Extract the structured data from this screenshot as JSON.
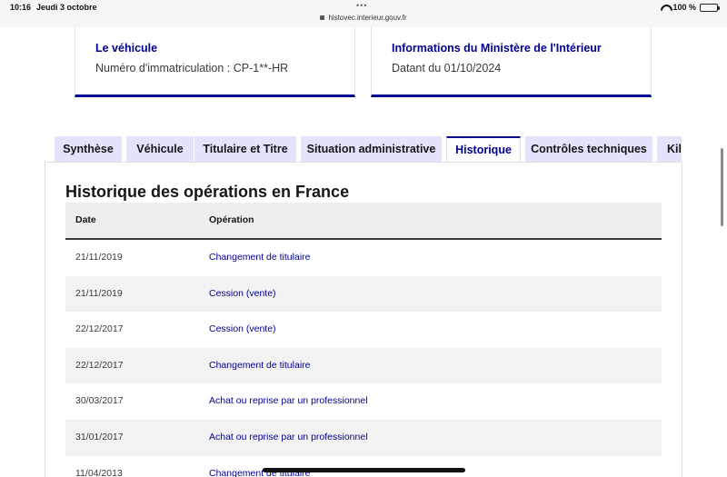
{
  "status_bar": {
    "time": "10:16",
    "date": "Jeudi 3 octobre",
    "url": "histovec.interieur.gouv.fr",
    "battery": "100 %"
  },
  "cards": [
    {
      "title": "Le véhicule",
      "text": "Numéro d'immatriculation : CP-1**-HR"
    },
    {
      "title": "Informations du Ministère de l'Intérieur",
      "text": "Datant du 01/10/2024"
    }
  ],
  "tabs": [
    {
      "label": "Synthèse",
      "active": false
    },
    {
      "label": "Véhicule",
      "active": false
    },
    {
      "label": "Titulaire et Titre",
      "active": false
    },
    {
      "label": "Situation administrative",
      "active": false
    },
    {
      "label": "Historique",
      "active": true
    },
    {
      "label": "Contrôles techniques",
      "active": false
    },
    {
      "label": "Kilométrage",
      "active": false
    }
  ],
  "history": {
    "title": "Historique des opérations en France",
    "columns": [
      "Date",
      "Opération"
    ],
    "rows": [
      {
        "date": "21/11/2019",
        "operation": "Changement de titulaire"
      },
      {
        "date": "21/11/2019",
        "operation": "Cession (vente)"
      },
      {
        "date": "22/12/2017",
        "operation": "Cession (vente)"
      },
      {
        "date": "22/12/2017",
        "operation": "Changement de titulaire"
      },
      {
        "date": "30/03/2017",
        "operation": "Achat ou reprise par un professionnel"
      },
      {
        "date": "31/01/2017",
        "operation": "Achat ou reprise par un professionnel"
      },
      {
        "date": "11/04/2013",
        "operation": "Changement de titulaire"
      }
    ]
  },
  "colors": {
    "primary": "#000091",
    "tab_background": "#e3e3fd",
    "row_alt": "#f2f2f2"
  }
}
